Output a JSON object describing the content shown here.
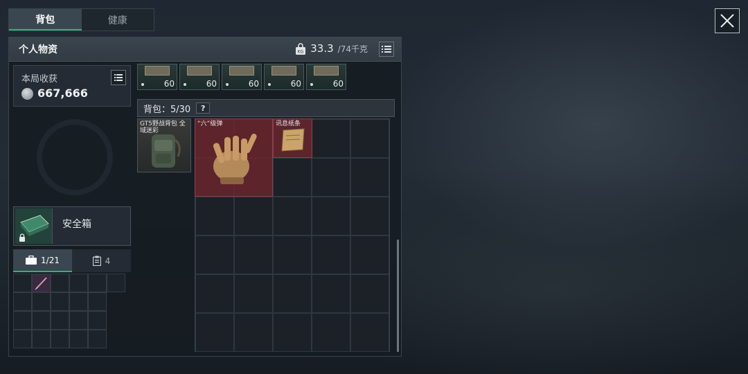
{
  "tabs": [
    {
      "label": "背包",
      "active": true
    },
    {
      "label": "健康",
      "active": false
    }
  ],
  "panel": {
    "title": "个人物资",
    "weight_current": "33.3",
    "weight_max": "/74千克"
  },
  "harvest": {
    "title": "本局收获",
    "value": "667,666"
  },
  "safebox": {
    "label": "安全箱",
    "tabs": [
      {
        "icon": "briefcase-icon",
        "label": "1/21",
        "active": true
      },
      {
        "icon": "clipboard-icon",
        "label": "4",
        "active": false
      }
    ]
  },
  "top_items": [
    {
      "qty": "60"
    },
    {
      "qty": "60"
    },
    {
      "qty": "60"
    },
    {
      "qty": "60"
    },
    {
      "qty": "60"
    }
  ],
  "backpack": {
    "label": "背包：5/30",
    "help": "?"
  },
  "items": {
    "gt5": "GT5野战背包 全域迷彩",
    "glove": "“六”级弹",
    "paper": "讯息纸条"
  },
  "colors": {
    "accent": "#2fb37e",
    "highlight_cell": "#6c242c"
  }
}
